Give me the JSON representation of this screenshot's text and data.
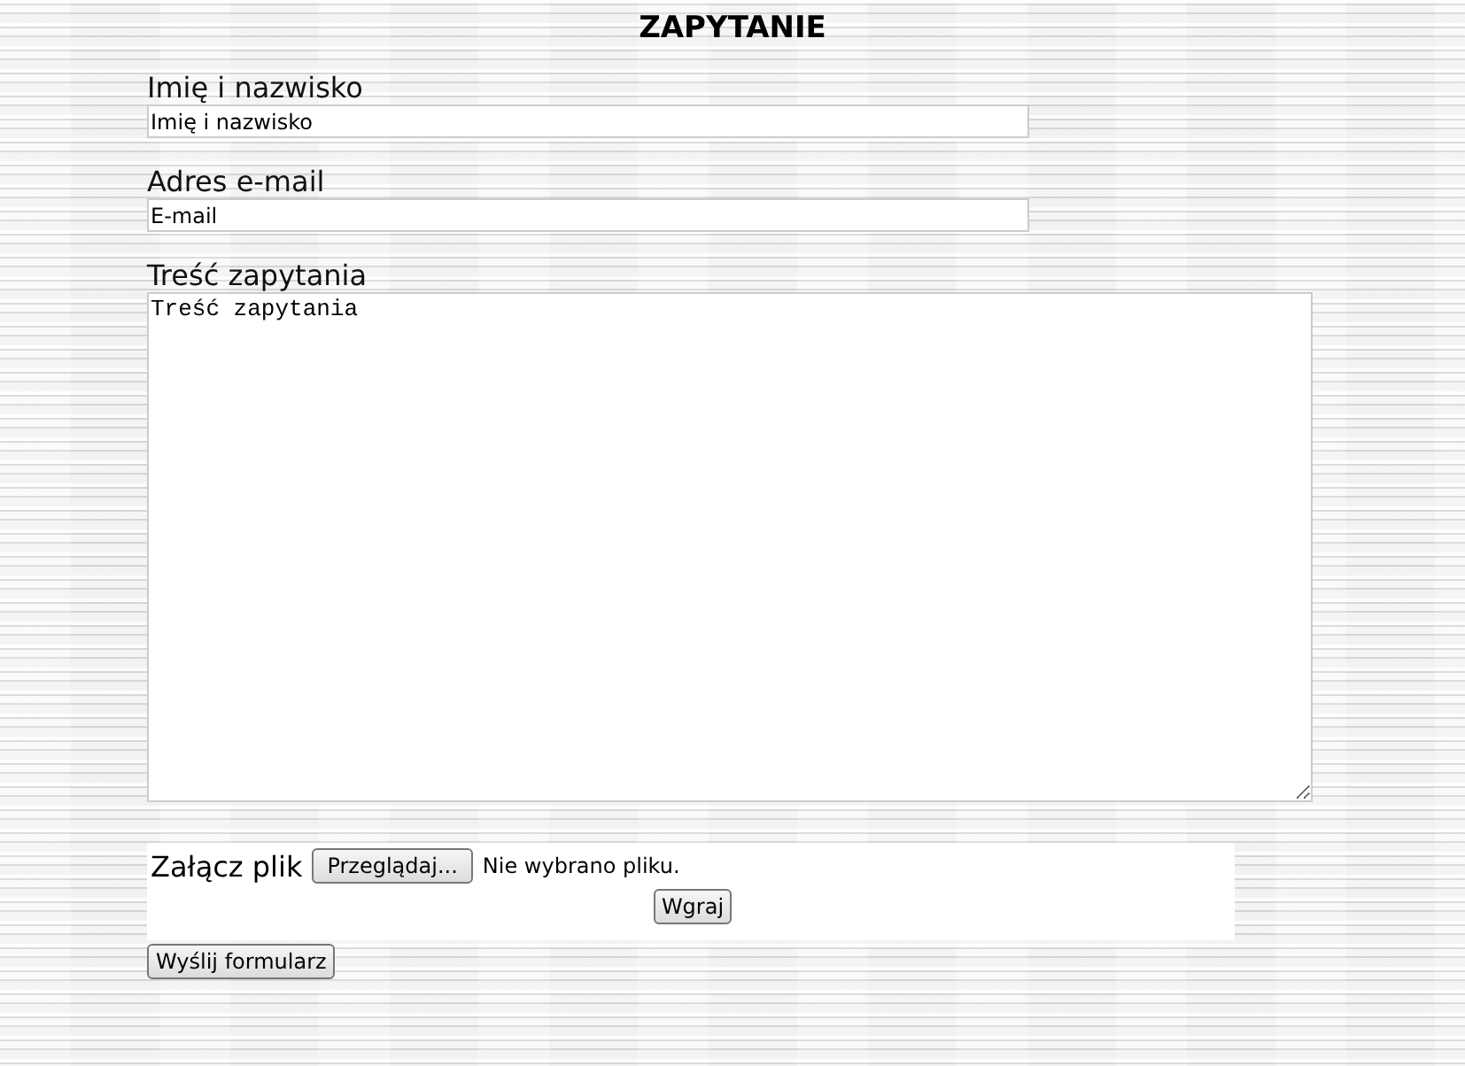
{
  "title": "ZAPYTANIE",
  "fields": [
    {
      "label": "Imię i nazwisko",
      "value": "Imię i nazwisko",
      "kind": "input"
    },
    {
      "label": "Adres e-mail",
      "value": "E-mail",
      "kind": "input"
    },
    {
      "label": "Treść zapytania",
      "value": "Treść zapytania",
      "kind": "textarea"
    }
  ],
  "attachment": {
    "label": "Załącz plik",
    "browse_button": "Przeglądaj...",
    "file_status": "Nie wybrano pliku.",
    "upload_button": "Wgraj"
  },
  "submit_button": "Wyślij formularz"
}
